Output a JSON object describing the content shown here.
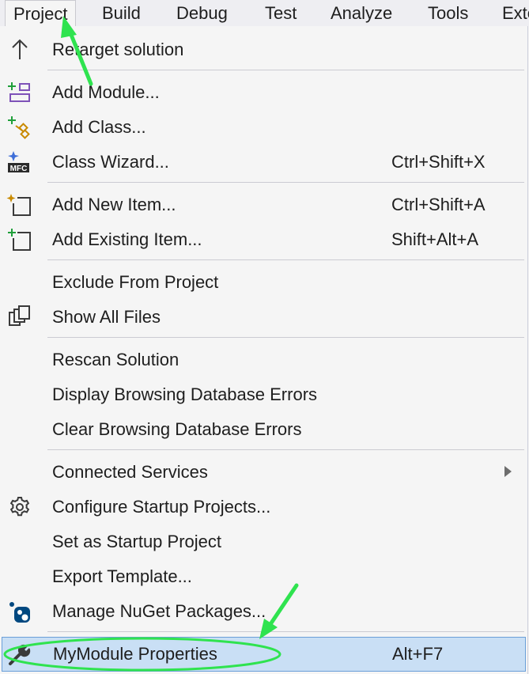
{
  "menubar": {
    "items": [
      {
        "label": "Project"
      },
      {
        "label": "Build"
      },
      {
        "label": "Debug"
      },
      {
        "label": "Test"
      },
      {
        "label": "Analyze"
      },
      {
        "label": "Tools"
      },
      {
        "label": "Exte"
      }
    ]
  },
  "menu": {
    "items": [
      {
        "label": "Retarget solution",
        "shortcut": "",
        "icon": "up-arrow-icon"
      },
      {
        "label": "Add Module...",
        "shortcut": "",
        "icon": "add-module-icon"
      },
      {
        "label": "Add Class...",
        "shortcut": "",
        "icon": "add-class-icon"
      },
      {
        "label": "Class Wizard...",
        "shortcut": "Ctrl+Shift+X",
        "icon": "class-wizard-icon",
        "icon_text": "MFC"
      },
      {
        "label": "Add New Item...",
        "shortcut": "Ctrl+Shift+A",
        "icon": "add-new-item-icon"
      },
      {
        "label": "Add Existing Item...",
        "shortcut": "Shift+Alt+A",
        "icon": "add-existing-item-icon"
      },
      {
        "label": "Exclude From Project",
        "shortcut": ""
      },
      {
        "label": "Show All Files",
        "shortcut": "",
        "icon": "show-all-files-icon"
      },
      {
        "label": "Rescan Solution",
        "shortcut": ""
      },
      {
        "label": "Display Browsing Database Errors",
        "shortcut": ""
      },
      {
        "label": "Clear Browsing Database Errors",
        "shortcut": ""
      },
      {
        "label": "Connected Services",
        "shortcut": "",
        "submenu": true
      },
      {
        "label": "Configure Startup Projects...",
        "shortcut": "",
        "icon": "gear-icon"
      },
      {
        "label": "Set as Startup Project",
        "shortcut": ""
      },
      {
        "label": "Export Template...",
        "shortcut": ""
      },
      {
        "label": "Manage NuGet Packages...",
        "shortcut": "",
        "icon": "nuget-icon"
      },
      {
        "label": "MyModule Properties",
        "shortcut": "Alt+F7",
        "icon": "wrench-icon",
        "highlighted": true
      }
    ]
  },
  "colors": {
    "highlight_bg": "#c9dff5",
    "highlight_border": "#6b9fd8",
    "annotation_green": "#2fe34f",
    "icon_green": "#1f9f3a",
    "icon_purple": "#7e52b8",
    "icon_dark": "#3a3a3a"
  }
}
